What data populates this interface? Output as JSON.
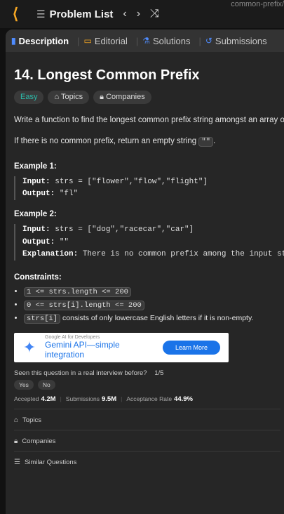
{
  "header": {
    "title": "Problem List",
    "url_fragment": "common-prefix/"
  },
  "tabs": [
    {
      "label": "Description"
    },
    {
      "label": "Editorial"
    },
    {
      "label": "Solutions"
    },
    {
      "label": "Submissions"
    }
  ],
  "problem": {
    "title": "14. Longest Common Prefix",
    "tags": [
      "Easy",
      "Topics",
      "Companies"
    ],
    "desc1": "Write a function to find the longest common prefix string amongst an array o",
    "desc2_prefix": "If there is no common prefix, return an empty string ",
    "desc2_code": "\"\"",
    "desc2_suffix": "."
  },
  "examples": [
    {
      "title": "Example 1:",
      "input_label": "Input:",
      "input": "strs = [\"flower\",\"flow\",\"flight\"]",
      "output_label": "Output:",
      "output": "\"fl\""
    },
    {
      "title": "Example 2:",
      "input_label": "Input:",
      "input": "strs = [\"dog\",\"racecar\",\"car\"]",
      "output_label": "Output:",
      "output": "\"\"",
      "explanation_label": "Explanation:",
      "explanation": "There is no common prefix among the input strings"
    }
  ],
  "constraints": {
    "title": "Constraints:",
    "items": [
      {
        "code": "1 <= strs.length <= 200",
        "text": ""
      },
      {
        "code": "0 <= strs[i].length <= 200",
        "text": ""
      },
      {
        "code": "strs[i]",
        "text": " consists of only lowercase English letters if it is non-empty."
      }
    ]
  },
  "ad": {
    "small": "Google AI for Developers",
    "line1": "Gemini API—simple",
    "line2": "integration",
    "cta": "Learn More"
  },
  "interview": {
    "question": "Seen this question in a real interview before?",
    "count": "1/5",
    "yes": "Yes",
    "no": "No"
  },
  "stats": {
    "accepted_label": "Accepted",
    "accepted": "4.2M",
    "submissions_label": "Submissions",
    "submissions": "9.5M",
    "rate_label": "Acceptance Rate",
    "rate": "44.9%"
  },
  "sections": {
    "topics": "Topics",
    "companies": "Companies",
    "similar": "Similar Questions"
  }
}
